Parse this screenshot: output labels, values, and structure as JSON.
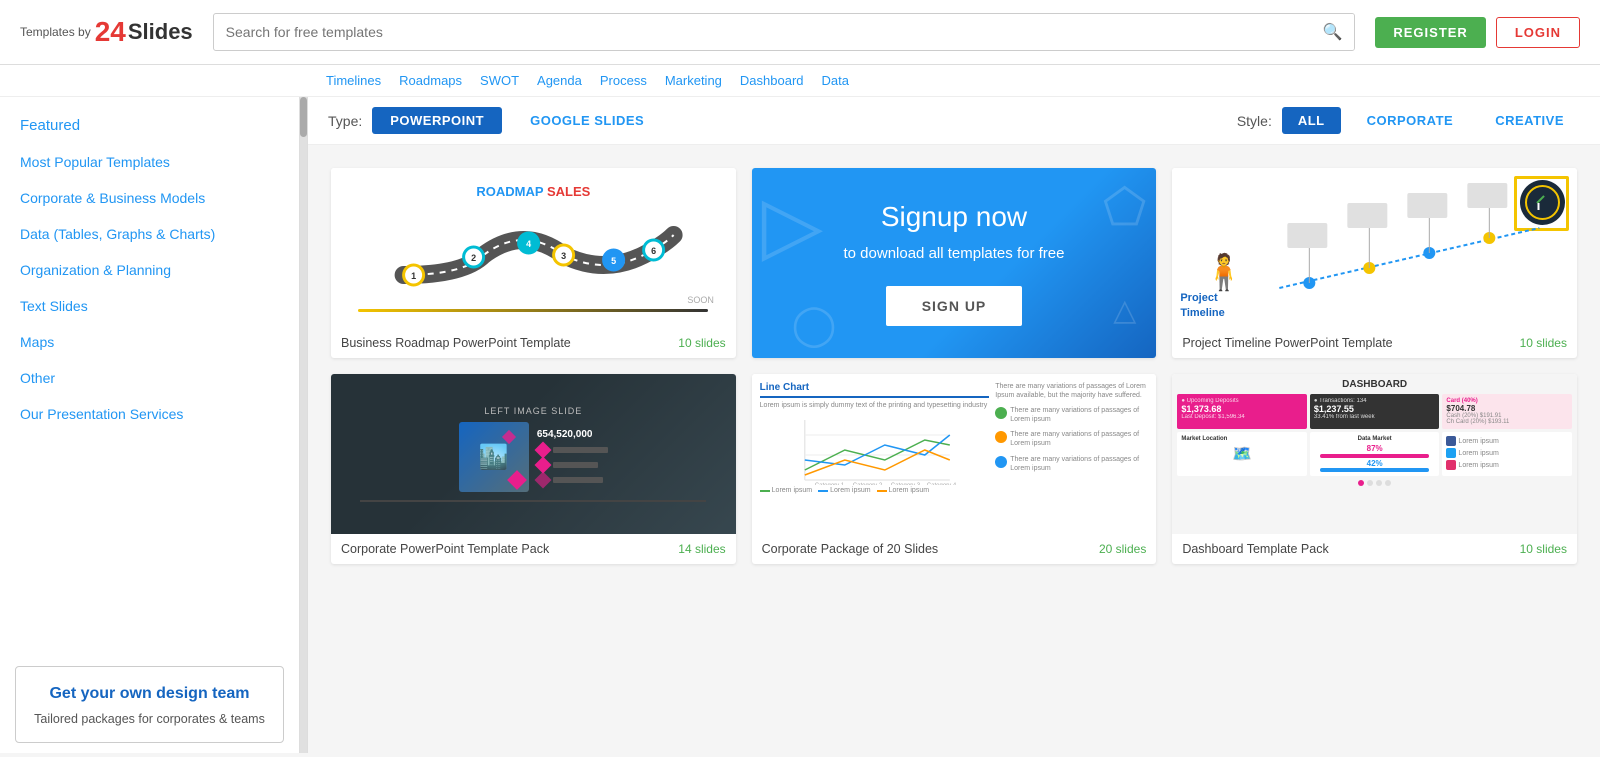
{
  "header": {
    "logo_prefix": "Templates by",
    "logo_number": "24",
    "logo_name": "Slides",
    "search_placeholder": "Search for free templates",
    "register_label": "REGISTER",
    "login_label": "LOGIN"
  },
  "subnav": {
    "items": [
      "Timelines",
      "Roadmaps",
      "SWOT",
      "Agenda",
      "Process",
      "Marketing",
      "Dashboard",
      "Data"
    ]
  },
  "sidebar": {
    "nav_items": [
      {
        "label": "Featured",
        "class": "featured"
      },
      {
        "label": "Most Popular Templates"
      },
      {
        "label": "Corporate & Business Models"
      },
      {
        "label": "Data (Tables, Graphs & Charts)"
      },
      {
        "label": "Organization & Planning"
      },
      {
        "label": "Text Slides"
      },
      {
        "label": "Maps"
      },
      {
        "label": "Other"
      },
      {
        "label": "Our Presentation Services"
      }
    ],
    "promo": {
      "title": "Get your own design team",
      "description": "Tailored packages for corporates & teams"
    }
  },
  "filter": {
    "type_label": "Type:",
    "type_buttons": [
      {
        "label": "POWERPOINT",
        "active": true
      },
      {
        "label": "GOOGLE SLIDES",
        "active": false
      }
    ],
    "style_label": "Style:",
    "style_buttons": [
      {
        "label": "ALL",
        "active": true
      },
      {
        "label": "CORPORATE",
        "active": false
      },
      {
        "label": "CREATIVE",
        "active": false
      }
    ]
  },
  "templates": [
    {
      "title": "Business Roadmap PowerPoint Template",
      "slides": "10 slides",
      "type": "roadmap"
    },
    {
      "title": "Signup now",
      "subtitle": "to download all templates for free",
      "cta": "SIGN UP",
      "type": "signup"
    },
    {
      "title": "Project Timeline PowerPoint Template",
      "slides": "10 slides",
      "type": "timeline"
    },
    {
      "title": "Corporate PowerPoint Template Pack",
      "slides": "14 slides",
      "type": "corporate"
    },
    {
      "title": "Corporate Package of 20 Slides",
      "slides": "20 slides",
      "type": "linechart"
    },
    {
      "title": "Dashboard Template Pack",
      "slides": "10 slides",
      "type": "dashboard"
    }
  ]
}
